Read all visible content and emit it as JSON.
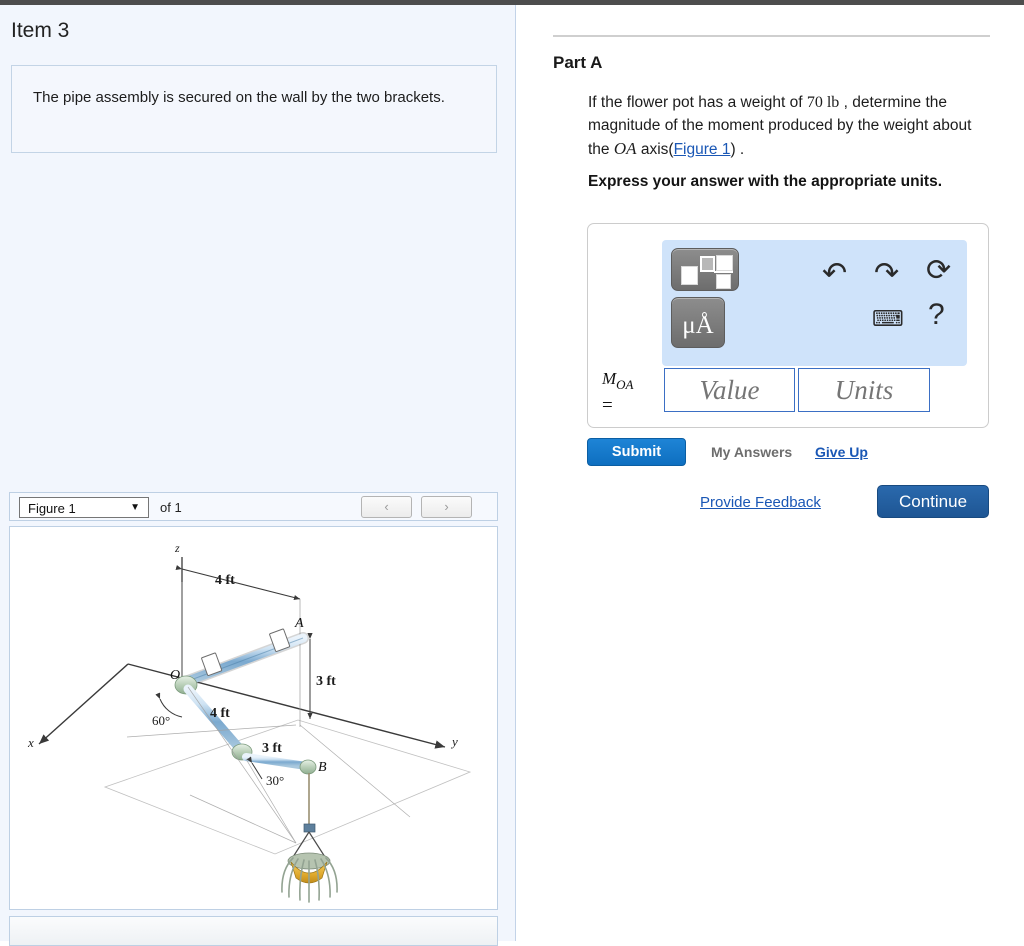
{
  "window": {
    "top_rule_color": "#4d4d4d"
  },
  "left": {
    "item_title": "Item 3",
    "statement": "The pipe assembly is secured on the wall by the two brackets.",
    "figure_bar": {
      "selected_figure": "Figure 1",
      "caret": "▼",
      "of_label": "of 1",
      "prev_label": "‹",
      "next_label": "›"
    }
  },
  "right": {
    "part_title": "Part A",
    "prompt": {
      "pre": "If the flower pot has a weight of ",
      "weight": "70 lb",
      "mid": " , determine the magnitude of the moment produced by the weight about the ",
      "axis": "OA",
      "axis_suffix": " axis(",
      "figure_link": "Figure 1",
      "tail": ") ."
    },
    "express_note": "Express your answer with the appropriate units.",
    "toolbar": {
      "template_button": "math-template-icon",
      "units_button": "μÅ",
      "undo": "↶",
      "redo": "↷",
      "reset": "⟳",
      "keyboard": "⌨",
      "help": "?"
    },
    "answer": {
      "label_main": "M",
      "label_sub": "OA",
      "label_eq": "=",
      "value_placeholder": "Value",
      "units_placeholder": "Units",
      "value": "",
      "units": ""
    },
    "actions": {
      "submit": "Submit",
      "my_answers": "My Answers",
      "give_up": "Give Up",
      "provide_feedback": "Provide Feedback",
      "continue": "Continue"
    },
    "colors": {
      "submit_blue": "#0e6fc0",
      "continue_blue": "#1e5694",
      "link_blue": "#1a57b5",
      "toolbar_blue": "#cfe3fa"
    }
  },
  "figure": {
    "title": "Figure 1",
    "labels": {
      "z_axis": "z",
      "x_axis": "x",
      "y_axis": "y",
      "point_O": "O",
      "point_A": "A",
      "point_B": "B",
      "dim_OA_horizontal": "4 ft",
      "dim_vertical": "3 ft",
      "dim_second_pipe": "4 ft",
      "dim_third_pipe": "3 ft",
      "angle_60": "60°",
      "angle_30": "30°"
    },
    "description": "3D pipe assembly anchored at O with brackets along segment OA, bent downward and supporting a hanging flower pot at B"
  }
}
